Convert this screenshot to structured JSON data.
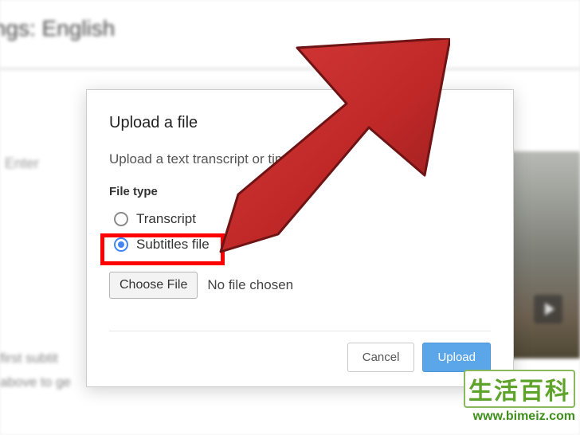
{
  "background": {
    "header": "nings: English",
    "enter_hint": "Enter",
    "footer_line1": "first subtit",
    "footer_line2": "above to ge"
  },
  "modal": {
    "title": "Upload a file",
    "instruction": "Upload a text transcript or timed",
    "filetype_label": "File type",
    "radios": {
      "transcript": "Transcript",
      "subtitles": "Subtitles file"
    },
    "choose_file": "Choose File",
    "no_file": "No file chosen",
    "cancel": "Cancel",
    "upload": "Upload"
  },
  "watermark": {
    "line1": "生活百科",
    "line2": "www.bimeiz.com"
  },
  "colors": {
    "highlight_red": "#ff0000",
    "arrow_red": "#c42a2a",
    "arrow_red_dark": "#8f1d1d",
    "primary_blue": "#5aa6e8",
    "radio_blue": "#4285f4",
    "watermark_green": "#5ea32a"
  }
}
